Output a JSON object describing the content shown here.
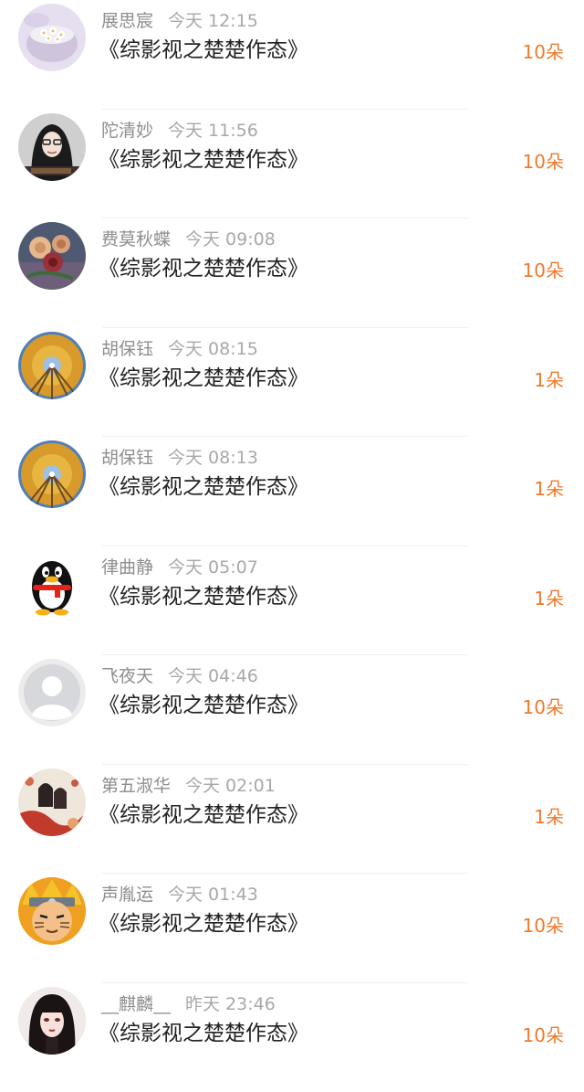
{
  "accent_color": "#f07a2b",
  "book_title": "《综影视之楚楚作态》",
  "gift_unit": "朵",
  "items": [
    {
      "name": "展思宸",
      "time": "今天 12:15",
      "gift": "10朵",
      "avatar": "flower-jar-avatar"
    },
    {
      "name": "陀清妙",
      "time": "今天 11:56",
      "gift": "10朵",
      "avatar": "girl-glasses-avatar"
    },
    {
      "name": "费莫秋蝶",
      "time": "今天 09:08",
      "gift": "10朵",
      "avatar": "roses-avatar"
    },
    {
      "name": "胡保钰",
      "time": "今天 08:15",
      "gift": "1朵",
      "avatar": "autumn-trees-avatar"
    },
    {
      "name": "胡保钰",
      "time": "今天 08:13",
      "gift": "1朵",
      "avatar": "autumn-trees-avatar"
    },
    {
      "name": "律曲静",
      "time": "今天 05:07",
      "gift": "1朵",
      "avatar": "penguin-avatar"
    },
    {
      "name": "飞夜天",
      "time": "今天 04:46",
      "gift": "10朵",
      "avatar": "default-person-avatar"
    },
    {
      "name": "第五淑华",
      "time": "今天 02:01",
      "gift": "1朵",
      "avatar": "illustration-couple-avatar"
    },
    {
      "name": "声胤运",
      "time": "今天 01:43",
      "gift": "10朵",
      "avatar": "ninja-avatar"
    },
    {
      "name": "__麒麟__",
      "time": "昨天 23:46",
      "gift": "10朵",
      "avatar": "anime-girl-avatar"
    }
  ]
}
